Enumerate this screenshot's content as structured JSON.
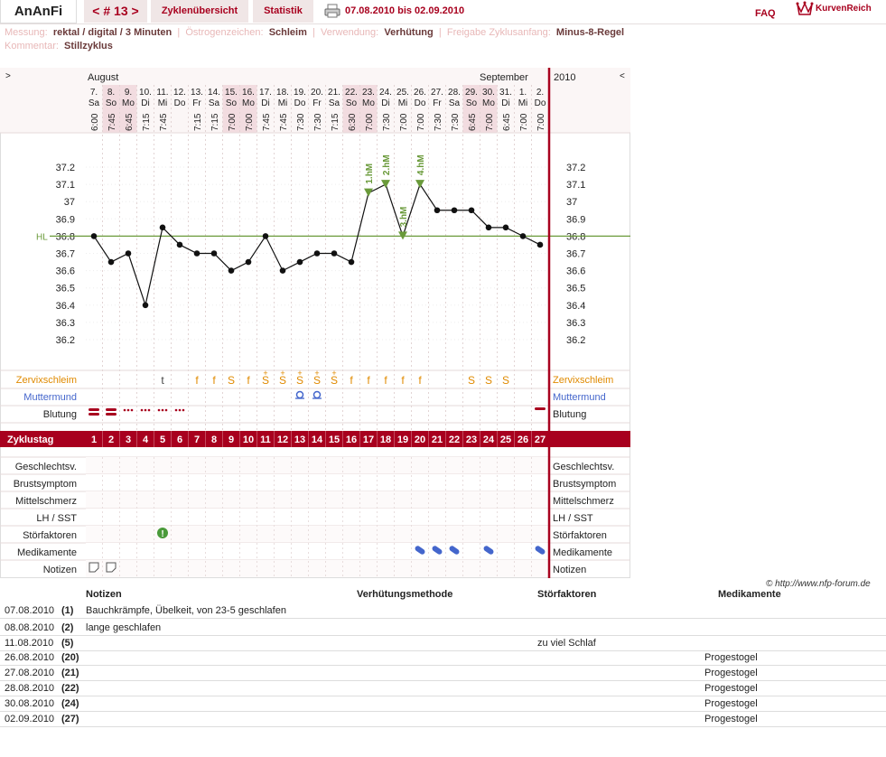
{
  "topbar": {
    "logo": "AnAnFi",
    "cycle": "< # 13 >",
    "overview": "Zyklenübersicht",
    "stats": "Statistik",
    "range": "07.08.2010 bis 02.09.2010",
    "faq": "FAQ",
    "brand": "KurvenReich"
  },
  "info": {
    "messung_label": "Messung:",
    "messung_value": "rektal / digital / 3 Minuten",
    "oestrogen_label": "Östrogenzeichen:",
    "oestrogen_value": "Schleim",
    "verwendung_label": "Verwendung:",
    "verwendung_value": "Verhütung",
    "freigabe_label": "Freigabe Zyklusanfang:",
    "freigabe_value": "Minus-8-Regel",
    "kommentar_label": "Kommentar:",
    "kommentar_value": "Stillzyklus"
  },
  "chart_data": {
    "type": "line",
    "title": "",
    "months": {
      "left": "August",
      "right": "September",
      "year": "2010"
    },
    "nav": {
      "left": ">",
      "right": "<"
    },
    "dates": [
      "7.",
      "8.",
      "9.",
      "10.",
      "11.",
      "12.",
      "13.",
      "14.",
      "15.",
      "16.",
      "17.",
      "18.",
      "19.",
      "20.",
      "21.",
      "22.",
      "23.",
      "24.",
      "25.",
      "26.",
      "27.",
      "28.",
      "29.",
      "30.",
      "31.",
      "1.",
      "2."
    ],
    "weekdays": [
      "Sa",
      "So",
      "Mo",
      "Di",
      "Mi",
      "Do",
      "Fr",
      "Sa",
      "So",
      "Mo",
      "Di",
      "Mi",
      "Do",
      "Fr",
      "Sa",
      "So",
      "Mo",
      "Di",
      "Mi",
      "Do",
      "Fr",
      "Sa",
      "So",
      "Mo",
      "Di",
      "Mi",
      "Do"
    ],
    "weekend_days": [
      1,
      2,
      8,
      9,
      15,
      16,
      22,
      23
    ],
    "times": [
      "6:00",
      "7:45",
      "6:45",
      "7:15",
      "7:45",
      "",
      "7:15",
      "7:15",
      "7:00",
      "7:00",
      "7:45",
      "7:45",
      "7:30",
      "7:30",
      "7:15",
      "6:30",
      "7:00",
      "7:30",
      "7:00",
      "7:00",
      "7:30",
      "7:30",
      "6:45",
      "7:00",
      "6:45",
      "7:00",
      "7:00"
    ],
    "cycle_days": [
      "1",
      "2",
      "3",
      "4",
      "5",
      "6",
      "7",
      "8",
      "9",
      "10",
      "11",
      "12",
      "13",
      "14",
      "15",
      "16",
      "17",
      "18",
      "19",
      "20",
      "21",
      "22",
      "23",
      "24",
      "25",
      "26",
      "27"
    ],
    "temps": [
      36.8,
      36.65,
      36.7,
      36.4,
      36.85,
      36.75,
      36.7,
      36.7,
      36.6,
      36.65,
      36.8,
      36.6,
      36.65,
      36.7,
      36.7,
      36.65,
      37.05,
      37.1,
      36.8,
      37.1,
      36.95,
      36.95,
      36.95,
      36.85,
      36.85,
      36.8,
      36.75
    ],
    "y_ticks": [
      "37.2",
      "37.1",
      "37",
      "36.9",
      "36.8",
      "36.7",
      "36.6",
      "36.5",
      "36.4",
      "36.3",
      "36.2"
    ],
    "ylim": [
      36.15,
      37.25
    ],
    "hl_label": "HL",
    "hl_value": 36.8,
    "high_markers": [
      {
        "day": 17,
        "label": "1.hM"
      },
      {
        "day": 18,
        "label": "2.hM"
      },
      {
        "day": 19,
        "label": "3.hM"
      },
      {
        "day": 20,
        "label": "4.hM"
      }
    ],
    "rows": {
      "cervix_label": "Zervixschleim",
      "cervix": [
        "",
        "",
        "",
        "",
        "t",
        "",
        "f",
        "f",
        "S",
        "f",
        "S+",
        "S+",
        "S+",
        "S+",
        "S+",
        "f",
        "f",
        "f",
        "f",
        "f",
        "",
        "",
        "S",
        "S",
        "S",
        "",
        ""
      ],
      "mumu_label": "Muttermund",
      "mumu_days": [
        13,
        14
      ],
      "bleeding_label": "Blutung",
      "bleeding": [
        "heavy",
        "heavy",
        "spot",
        "spot",
        "spot",
        "spot",
        "",
        "",
        "",
        "",
        "",
        "",
        "",
        "",
        "",
        "",
        "",
        "",
        "",
        "",
        "",
        "",
        "",
        "",
        "",
        "",
        "light"
      ],
      "cycle_label": "Zyklustag",
      "sex_label": "Geschlechtsv.",
      "breast_label": "Brustsymptom",
      "mittel_label": "Mittelschmerz",
      "lh_label": "LH / SST",
      "stoer_label": "Störfaktoren",
      "stoer_days": [
        5
      ],
      "med_label": "Medikamente",
      "med_days": [
        20,
        21,
        22,
        24,
        27
      ],
      "notes_label": "Notizen",
      "notes_days": [
        1,
        2
      ]
    },
    "colors": {
      "line": "#111111",
      "hl": "#6a9a3a",
      "accent": "#a8001e",
      "cervix": "#e08a00",
      "mumu": "#4466cc",
      "weekend": "#f2dce0"
    }
  },
  "copyright": "© http://www.nfp-forum.de",
  "notes_table": {
    "headers": {
      "notes": "Notizen",
      "method": "Verhütungsmethode",
      "stoer": "Störfaktoren",
      "med": "Medikamente"
    },
    "rows": [
      {
        "date": "07.08.2010",
        "day": "(1)",
        "note": "Bauchkrämpfe, Übelkeit, von 23-5 geschlafen",
        "method": "",
        "stoer": "",
        "med": ""
      },
      {
        "date": "08.08.2010",
        "day": "(2)",
        "note": "lange geschlafen",
        "method": "",
        "stoer": "",
        "med": ""
      },
      {
        "date": "11.08.2010",
        "day": "(5)",
        "note": "",
        "method": "",
        "stoer": "zu viel Schlaf",
        "med": ""
      },
      {
        "date": "26.08.2010",
        "day": "(20)",
        "note": "",
        "method": "",
        "stoer": "",
        "med": "Progestogel"
      },
      {
        "date": "27.08.2010",
        "day": "(21)",
        "note": "",
        "method": "",
        "stoer": "",
        "med": "Progestogel"
      },
      {
        "date": "28.08.2010",
        "day": "(22)",
        "note": "",
        "method": "",
        "stoer": "",
        "med": "Progestogel"
      },
      {
        "date": "30.08.2010",
        "day": "(24)",
        "note": "",
        "method": "",
        "stoer": "",
        "med": "Progestogel"
      },
      {
        "date": "02.09.2010",
        "day": "(27)",
        "note": "",
        "method": "",
        "stoer": "",
        "med": "Progestogel"
      }
    ]
  }
}
